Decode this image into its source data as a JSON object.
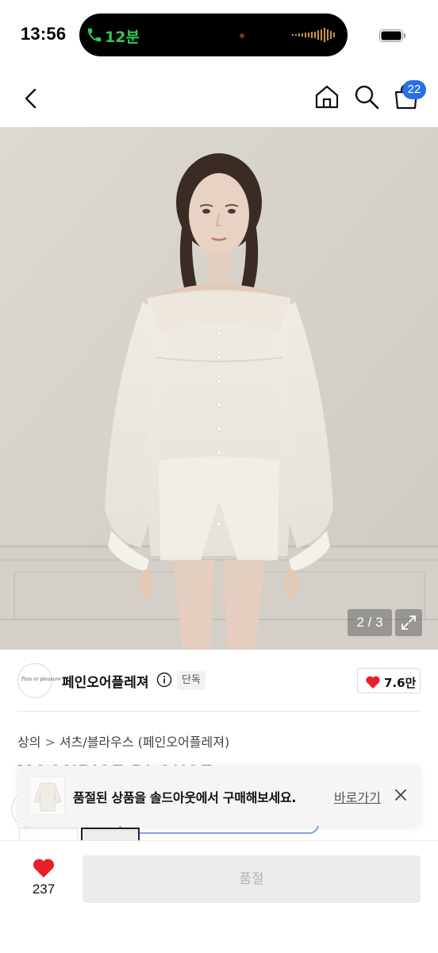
{
  "status_bar": {
    "time": "13:56",
    "call_duration": "12분"
  },
  "nav": {
    "cart_count": "22"
  },
  "gallery": {
    "page_indicator": "2 / 3"
  },
  "shop": {
    "name": "페인오어플레져",
    "logo_text": "Pain or pleasure",
    "tag": "단독",
    "likes": "7.6만"
  },
  "breadcrumb": {
    "category": "상의",
    "separator": ">",
    "subcategory": "셔츠/블라우스 (페인오어플레져)"
  },
  "product": {
    "title": "MOONRISE BLOUSE"
  },
  "toast": {
    "message": "품절된 상품을 솔드아웃에서 구매해보세요.",
    "link_label": "바로가기"
  },
  "bottom": {
    "wish_count": "237",
    "buy_label": "품절"
  },
  "colors": {
    "accent_blue": "#2a6fe8",
    "heart_red": "#e8202a",
    "call_green": "#34c759"
  }
}
